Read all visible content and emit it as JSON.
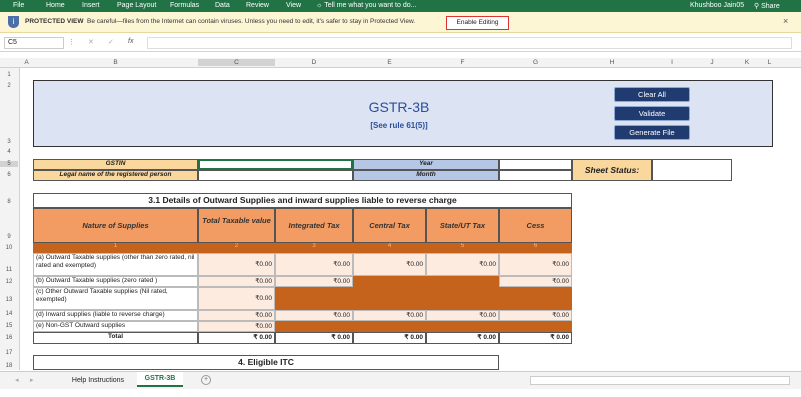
{
  "ribbon": {
    "tabs": [
      "File",
      "Home",
      "Insert",
      "Page Layout",
      "Formulas",
      "Data",
      "Review",
      "View"
    ],
    "tell_me": "Tell me what you want to do...",
    "user": "Khushboo Jain05",
    "share": "Share"
  },
  "protected_view": {
    "label": "PROTECTED VIEW",
    "message": "Be careful—files from the Internet can contain viruses. Unless you need to edit, it's safer to stay in Protected View.",
    "button": "Enable Editing",
    "close": "×"
  },
  "formula_bar": {
    "name_box": "C5",
    "fx": "fx"
  },
  "columns": [
    "A",
    "B",
    "C",
    "D",
    "E",
    "F",
    "G",
    "H",
    "I",
    "J",
    "K",
    "L"
  ],
  "rows": [
    "1",
    "2",
    "3",
    "4",
    "5",
    "6",
    "7",
    "8",
    "9",
    "10",
    "11",
    "12",
    "13",
    "14",
    "15",
    "16",
    "17",
    "18"
  ],
  "title": {
    "main": "GSTR-3B",
    "sub": "[See rule 61(5)]"
  },
  "buttons": {
    "clear": "Clear All",
    "validate": "Validate",
    "generate": "Generate File"
  },
  "info": {
    "gstin": "GSTIN",
    "legal": "Legal name of the registered person",
    "year": "Year",
    "month": "Month",
    "status": "Sheet Status:"
  },
  "section31": {
    "title": "3.1 Details of Outward Supplies and inward supplies liable to reverse charge",
    "headers": [
      "Nature of Supplies",
      "Total Taxable value",
      "Integrated Tax",
      "Central Tax",
      "State/UT Tax",
      "Cess"
    ],
    "numbers": [
      "1",
      "2",
      "3",
      "4",
      "5",
      "6"
    ],
    "rows": [
      {
        "label": "(a) Outward Taxable supplies (other than zero rated, nil rated and exempted)",
        "v": [
          "₹0.00",
          "₹0.00",
          "₹0.00",
          "₹0.00",
          "₹0.00"
        ]
      },
      {
        "label": "(b) Outward Taxable supplies (zero rated )",
        "v": [
          "₹0.00",
          "₹0.00",
          "",
          "",
          "₹0.00"
        ]
      },
      {
        "label": "(c) Other Outward Taxable supplies (Nil rated, exempted)",
        "v": [
          "₹0.00",
          "",
          "",
          "",
          ""
        ]
      },
      {
        "label": "(d) Inward supplies (liable to reverse charge)",
        "v": [
          "₹0.00",
          "₹0.00",
          "₹0.00",
          "₹0.00",
          "₹0.00"
        ]
      },
      {
        "label": "(e) Non-GST Outward supplies",
        "v": [
          "₹0.00",
          "",
          "",
          "",
          ""
        ]
      }
    ],
    "total": {
      "label": "Total",
      "v": [
        "₹ 0.00",
        "₹ 0.00",
        "₹ 0.00",
        "₹ 0.00",
        "₹ 0.00"
      ]
    }
  },
  "section4": {
    "title": "4. Eligible ITC"
  },
  "sheets": {
    "tabs": [
      "Help Instructions",
      "GSTR-3B"
    ],
    "active": "GSTR-3B",
    "add": "+"
  }
}
